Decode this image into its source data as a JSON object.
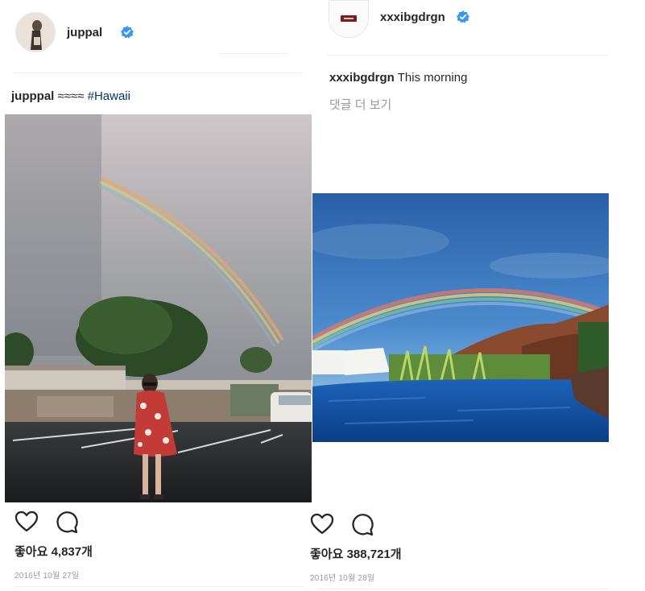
{
  "post1": {
    "username": "juppal",
    "caption_user": "jupppal",
    "caption_emoji": "≈≈≈≈",
    "caption_tag": "#Hawaii",
    "likes": "좋아요 4,837개",
    "date": "2016년 10월 27일"
  },
  "post2": {
    "username": "xxxibgdrgn",
    "caption_user": "xxxibgdrgn",
    "caption_text": " This morning",
    "more_comments": "댓글 더 보기",
    "likes": "좋아요 388,721개",
    "date": "2016년 10월 28일"
  },
  "icons": {
    "like": "heart-icon",
    "comment": "comment-bubble-icon",
    "verified": "verified-badge-icon"
  },
  "colors": {
    "verified_blue": "#3897f0",
    "hashtag": "#003569",
    "meta_gray": "#999999"
  }
}
